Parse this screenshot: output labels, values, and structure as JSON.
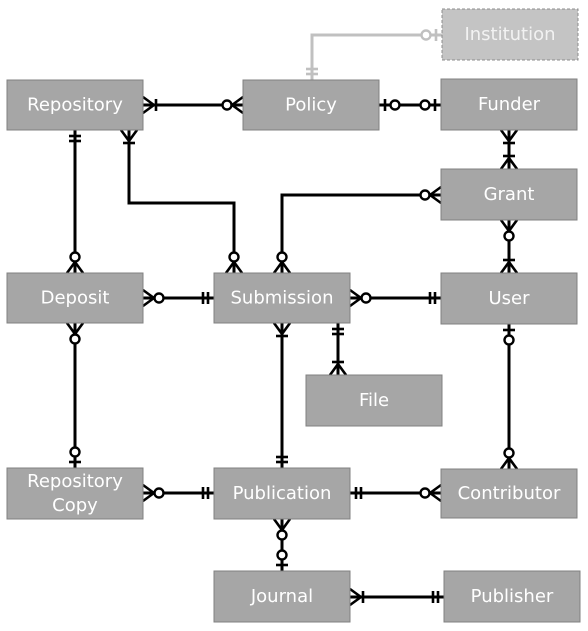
{
  "diagram": {
    "type": "entity-relationship",
    "entities": [
      {
        "id": "institution",
        "label": "Institution",
        "optional": true
      },
      {
        "id": "repository",
        "label": "Repository"
      },
      {
        "id": "policy",
        "label": "Policy"
      },
      {
        "id": "funder",
        "label": "Funder"
      },
      {
        "id": "grant",
        "label": "Grant"
      },
      {
        "id": "deposit",
        "label": "Deposit"
      },
      {
        "id": "submission",
        "label": "Submission"
      },
      {
        "id": "user",
        "label": "User"
      },
      {
        "id": "file",
        "label": "File"
      },
      {
        "id": "repository_copy",
        "label": "Repository Copy",
        "lines": [
          "Repository",
          "Copy"
        ]
      },
      {
        "id": "publication",
        "label": "Publication"
      },
      {
        "id": "contributor",
        "label": "Contributor"
      },
      {
        "id": "journal",
        "label": "Journal"
      },
      {
        "id": "publisher",
        "label": "Publisher"
      }
    ],
    "relationships": [
      {
        "from": "policy",
        "from_card": "exactly-one",
        "to": "institution",
        "to_card": "zero-or-one",
        "optional": true
      },
      {
        "from": "repository",
        "from_card": "one-or-many",
        "to": "policy",
        "to_card": "zero-or-many"
      },
      {
        "from": "policy",
        "from_card": "zero-or-one",
        "to": "funder",
        "to_card": "zero-or-one"
      },
      {
        "from": "funder",
        "from_card": "one-or-many",
        "to": "grant",
        "to_card": "one-or-many"
      },
      {
        "from": "repository",
        "from_card": "exactly-one",
        "to": "deposit",
        "to_card": "zero-or-many"
      },
      {
        "from": "repository",
        "from_card": "one-or-many",
        "to": "submission",
        "to_card": "zero-or-many"
      },
      {
        "from": "grant",
        "from_card": "zero-or-many",
        "to": "submission",
        "to_card": "zero-or-many"
      },
      {
        "from": "grant",
        "from_card": "zero-or-many",
        "to": "user",
        "to_card": "one-or-many"
      },
      {
        "from": "deposit",
        "from_card": "zero-or-many",
        "to": "submission",
        "to_card": "exactly-one"
      },
      {
        "from": "submission",
        "from_card": "zero-or-many",
        "to": "user",
        "to_card": "exactly-one"
      },
      {
        "from": "submission",
        "from_card": "exactly-one",
        "to": "file",
        "to_card": "one-or-many"
      },
      {
        "from": "deposit",
        "from_card": "zero-or-many",
        "to": "repository_copy",
        "to_card": "zero-or-one"
      },
      {
        "from": "submission",
        "from_card": "one-or-many",
        "to": "publication",
        "to_card": "exactly-one"
      },
      {
        "from": "user",
        "from_card": "zero-or-one",
        "to": "contributor",
        "to_card": "zero-or-many"
      },
      {
        "from": "repository_copy",
        "from_card": "zero-or-many",
        "to": "publication",
        "to_card": "exactly-one"
      },
      {
        "from": "publication",
        "from_card": "exactly-one",
        "to": "contributor",
        "to_card": "zero-or-many"
      },
      {
        "from": "publication",
        "from_card": "zero-or-many",
        "to": "journal",
        "to_card": "zero-or-one"
      },
      {
        "from": "journal",
        "from_card": "one-or-many",
        "to": "publisher",
        "to_card": "exactly-one"
      }
    ]
  }
}
